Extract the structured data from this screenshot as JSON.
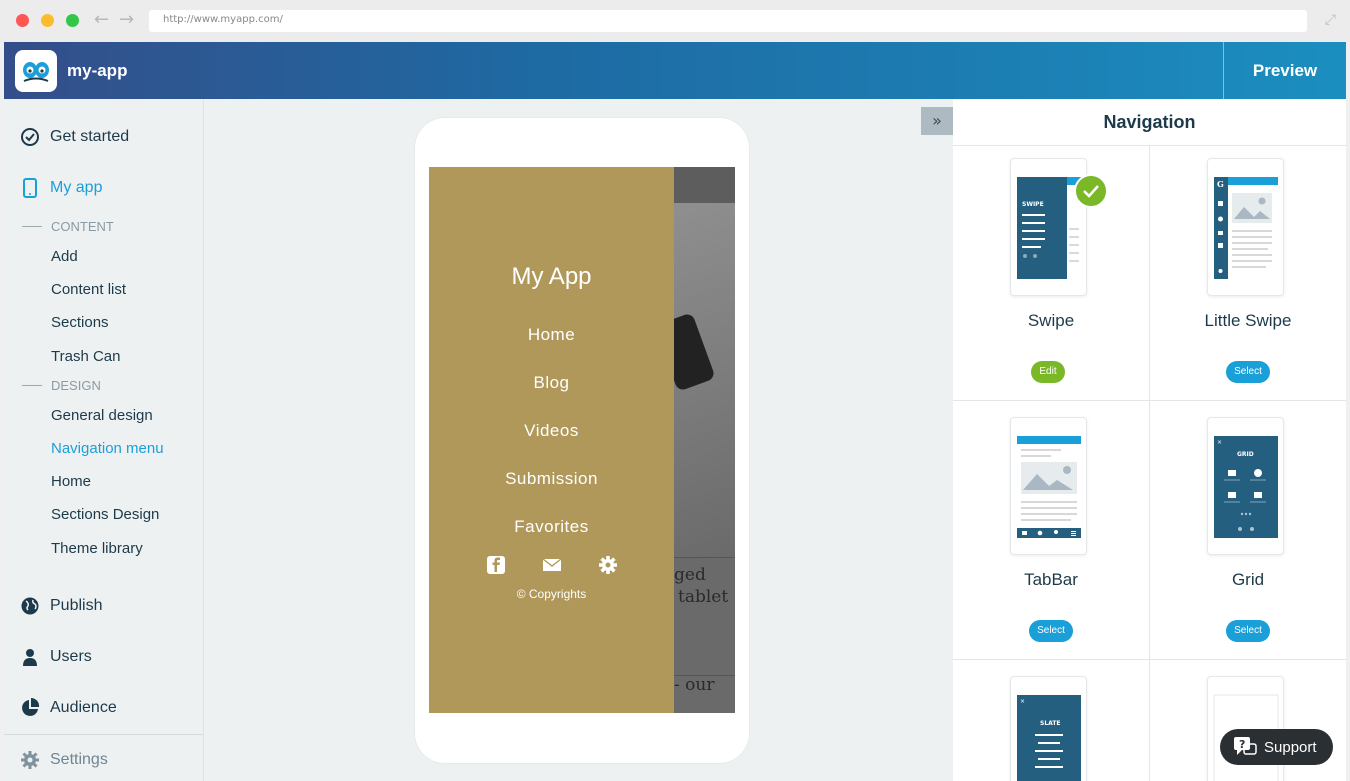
{
  "browser": {
    "url": "http://www.myapp.com/"
  },
  "header": {
    "app_name": "my-app",
    "preview_label": "Preview"
  },
  "sidebar": {
    "get_started": "Get started",
    "my_app": "My app",
    "content_section": "CONTENT",
    "content_items": [
      "Add",
      "Content list",
      "Sections",
      "Trash Can"
    ],
    "design_section": "DESIGN",
    "design_items": [
      "General design",
      "Navigation menu",
      "Home",
      "Sections Design",
      "Theme library"
    ],
    "active_item": "Navigation menu",
    "publish": "Publish",
    "users": "Users",
    "audience": "Audience",
    "settings": "Settings"
  },
  "preview": {
    "drawer_title": "My App",
    "menu_items": [
      "Home",
      "Blog",
      "Videos",
      "Submission",
      "Favorites"
    ],
    "copyright": "© Copyrights",
    "background_text_1": "ged",
    "background_text_2": "tablet",
    "background_text_3": "- our"
  },
  "panel": {
    "title": "Navigation",
    "styles": [
      {
        "name": "Swipe",
        "action": "Edit",
        "selected": true,
        "thumb_label": "SWIPE"
      },
      {
        "name": "Little Swipe",
        "action": "Select",
        "selected": false,
        "thumb_label": "G"
      },
      {
        "name": "TabBar",
        "action": "Select",
        "selected": false,
        "thumb_label": ""
      },
      {
        "name": "Grid",
        "action": "Select",
        "selected": false,
        "thumb_label": "GRID"
      },
      {
        "name": "",
        "action": "",
        "selected": false,
        "thumb_label": "SLATE"
      }
    ]
  },
  "support": {
    "label": "Support"
  },
  "colors": {
    "accent": "#1aa0d8",
    "edit_green": "#7ab828",
    "drawer_gold": "#b0985a",
    "thumb_blue": "#255f80"
  }
}
